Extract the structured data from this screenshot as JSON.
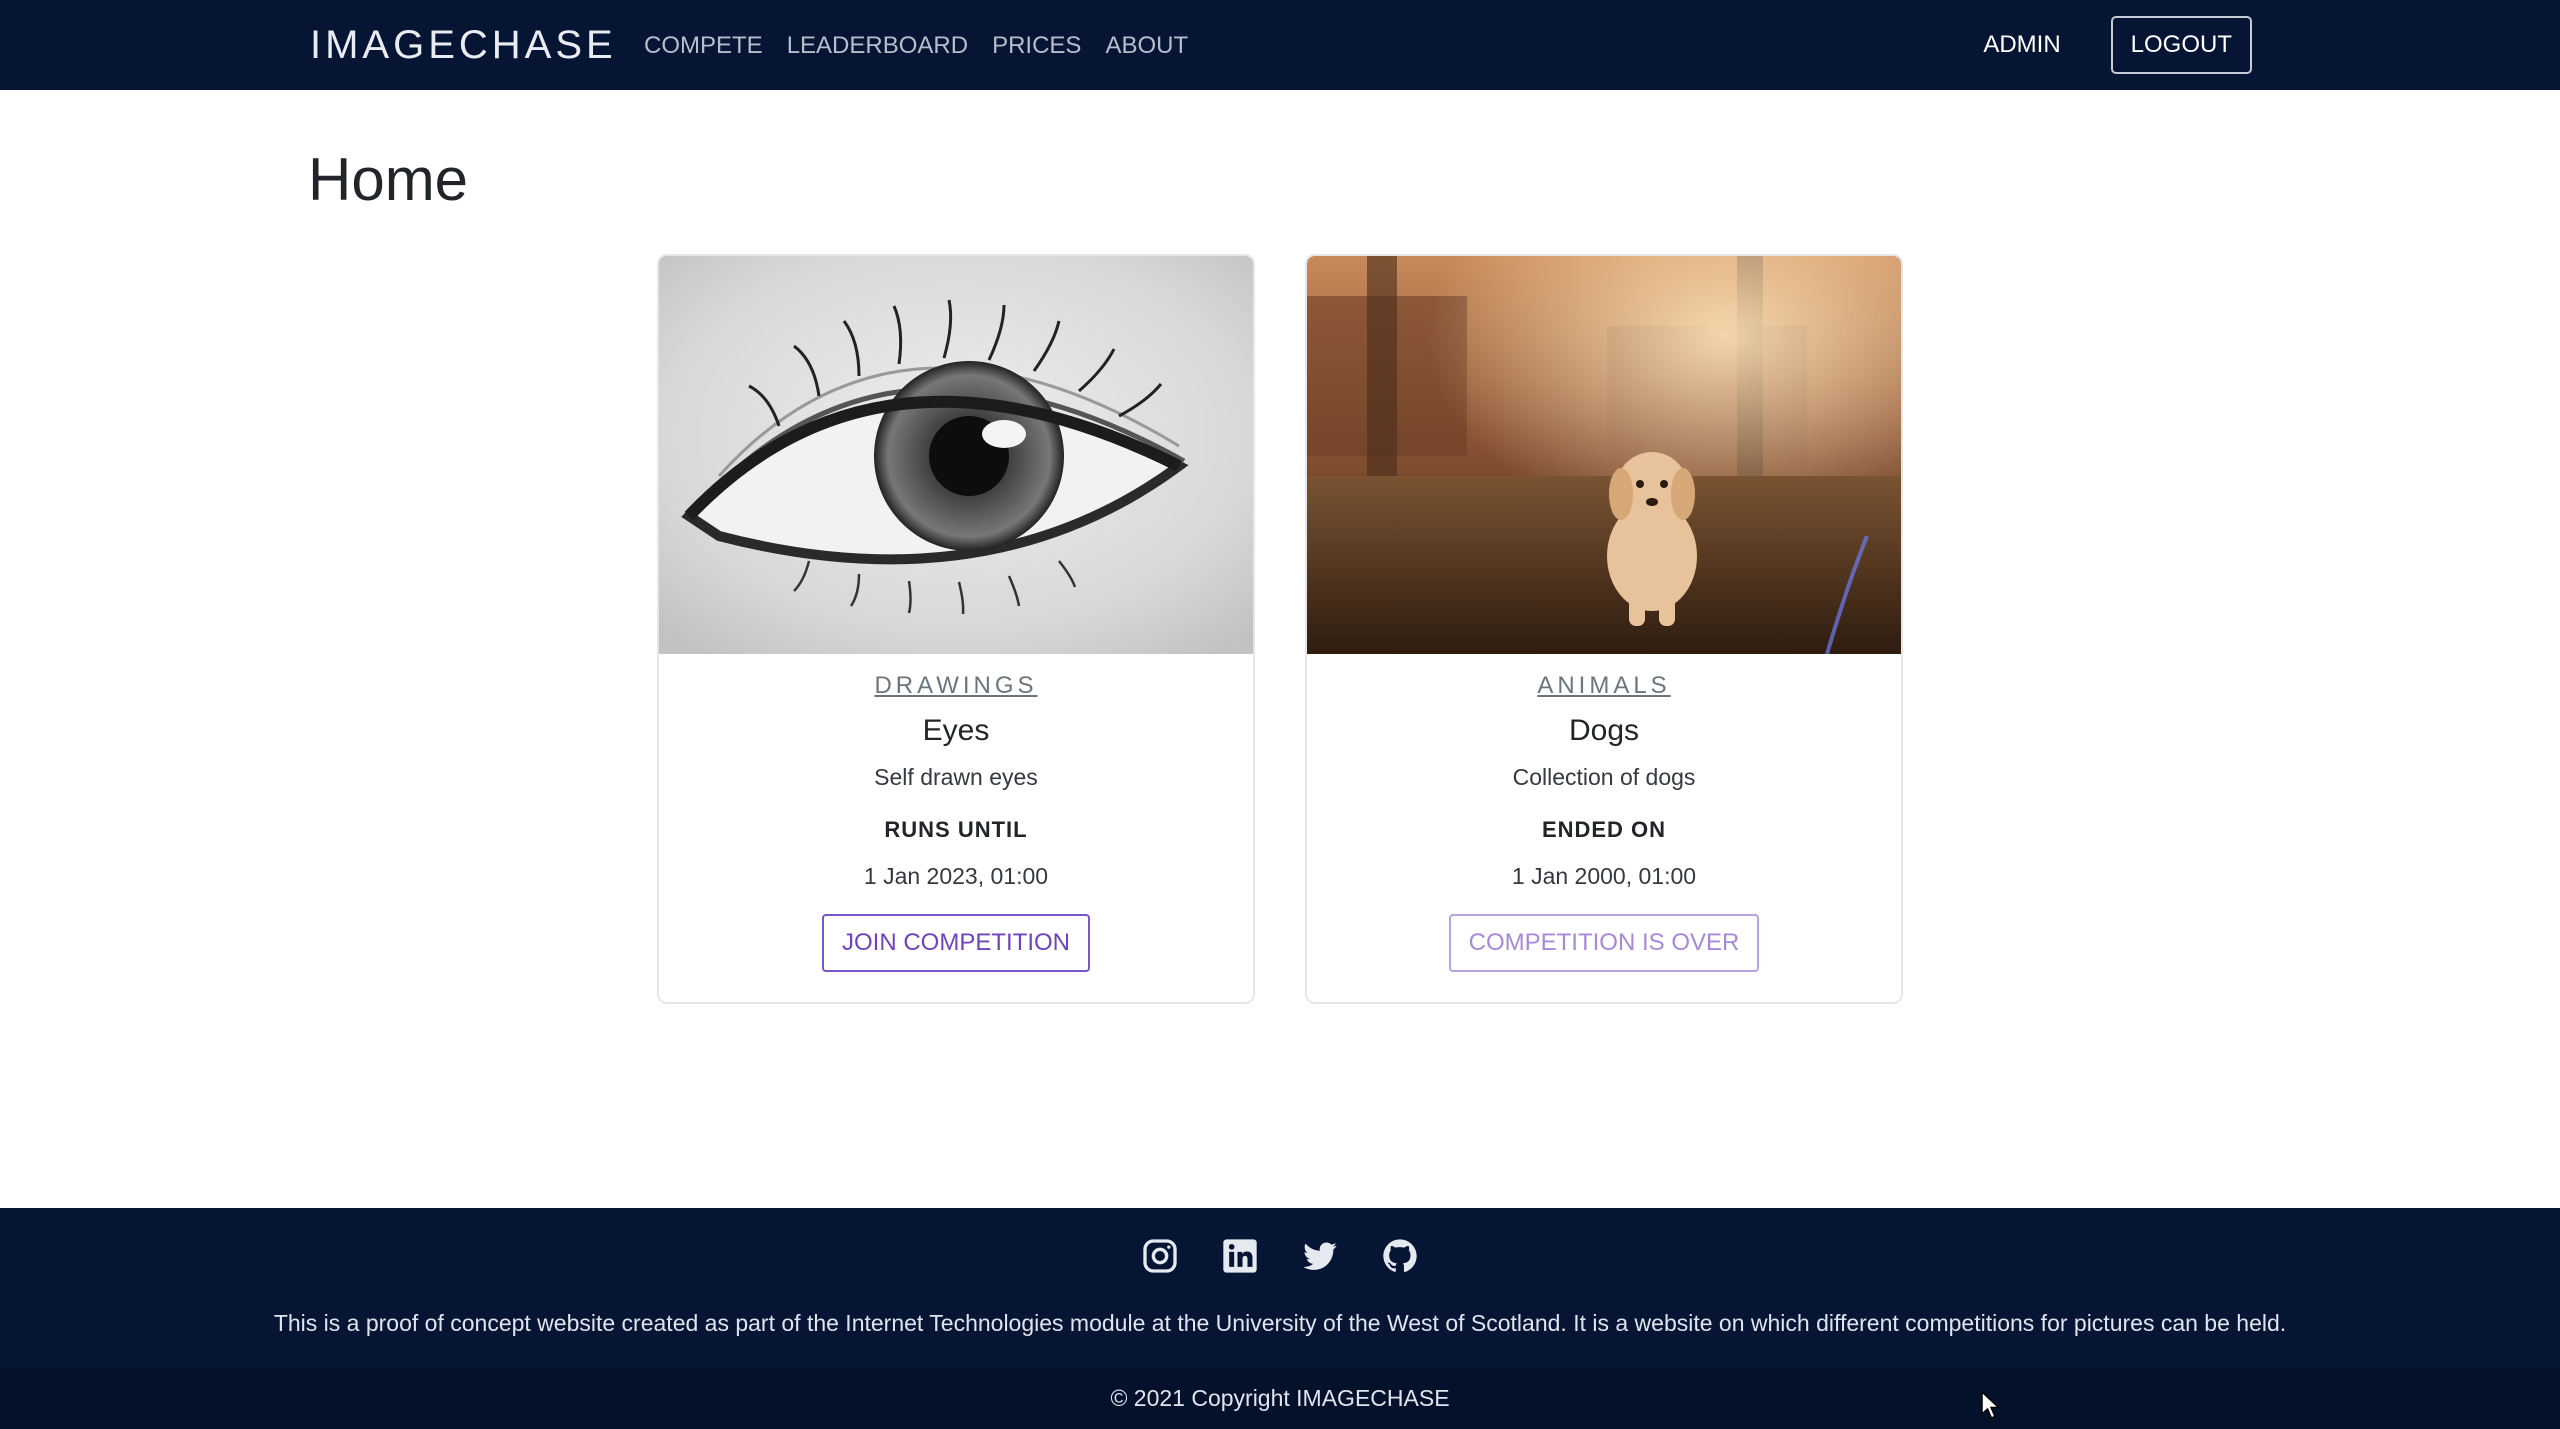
{
  "nav": {
    "brand": "IMAGECHASE",
    "links": [
      "COMPETE",
      "LEADERBOARD",
      "PRICES",
      "ABOUT"
    ],
    "admin": "ADMIN",
    "logout": "LOGOUT"
  },
  "page": {
    "title": "Home"
  },
  "competitions": [
    {
      "category": "DRAWINGS",
      "title": "Eyes",
      "description": "Self drawn eyes",
      "date_label": "RUNS UNTIL",
      "date": "1 Jan 2023, 01:00",
      "action": "JOIN COMPETITION",
      "action_enabled": true,
      "image_icon": "eye-drawing-image"
    },
    {
      "category": "ANIMALS",
      "title": "Dogs",
      "description": "Collection of dogs",
      "date_label": "ENDED ON",
      "date": "1 Jan 2000, 01:00",
      "action": "COMPETITION IS OVER",
      "action_enabled": false,
      "image_icon": "puppy-photo-image"
    }
  ],
  "footer": {
    "social_icons": [
      "instagram-icon",
      "linkedin-icon",
      "twitter-icon",
      "github-icon"
    ],
    "text": "This is a proof of concept website created as part of the Internet Technologies module at the University of the West of Scotland. It is a website on which different competitions for pictures can be held.",
    "copyright": "© 2021 Copyright IMAGECHASE"
  },
  "colors": {
    "navbar": "#051533",
    "accent": "#6f43c0",
    "footer": "#051533"
  }
}
